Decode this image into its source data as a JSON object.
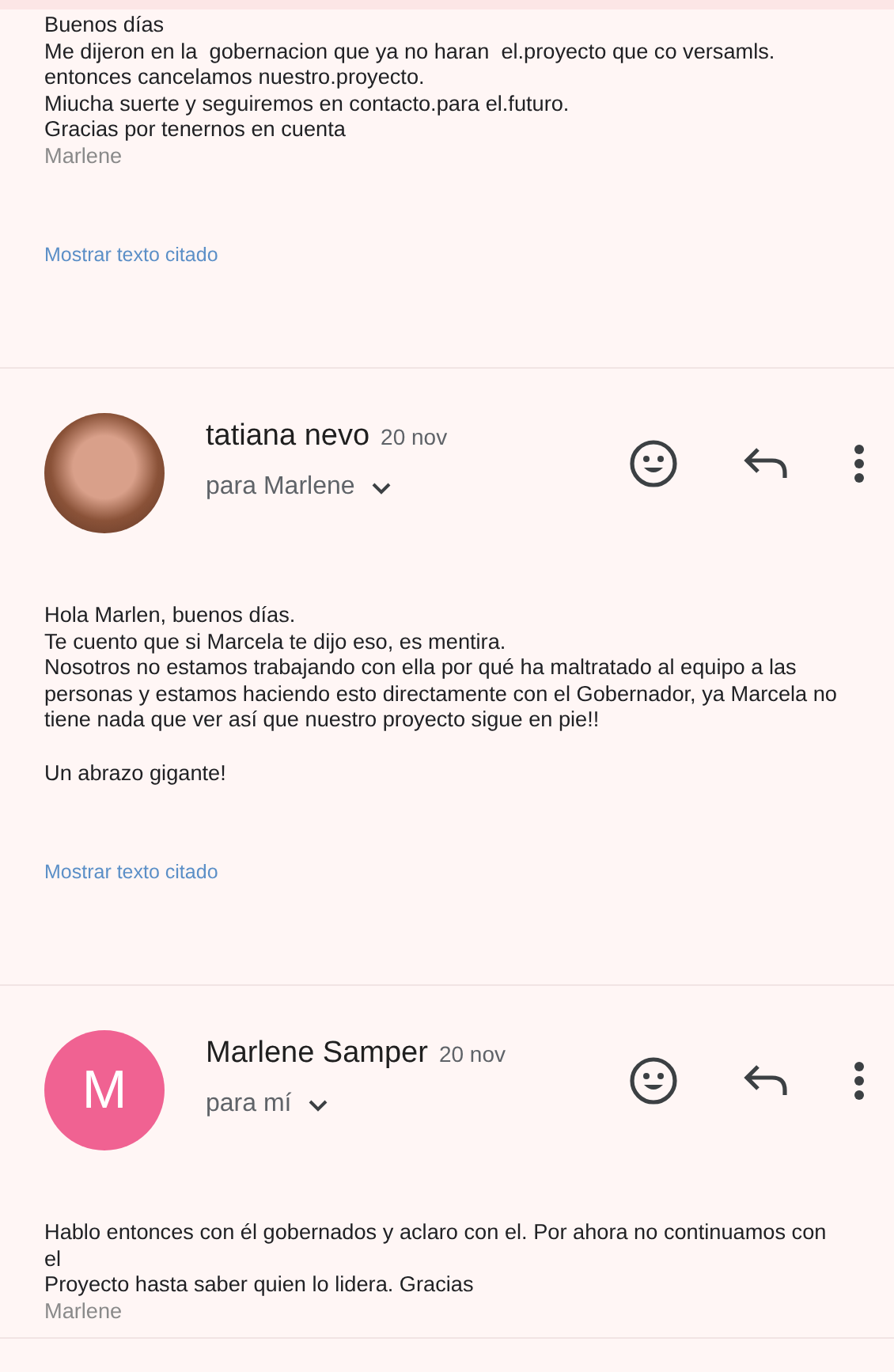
{
  "messages": [
    {
      "blocks": [
        {
          "lines": [
            "Buenos días",
            "Me dijeron en la  gobernacion que ya no haran  el.proyecto que co versamls.",
            "entonces cancelamos nuestro.proyecto.",
            "Miucha suerte y seguiremos en contacto.para el.futuro.",
            "Gracias por tenernos en cuenta"
          ]
        }
      ],
      "signature": "Marlene",
      "quoted_link": "Mostrar texto citado"
    },
    {
      "header": {
        "sender": "tatiana nevo",
        "date": "20 nov",
        "recipient": "para Marlene",
        "avatar": {
          "kind": "photo"
        }
      },
      "blocks": [
        {
          "lines": [
            "Hola Marlen, buenos días.",
            "Te cuento que si Marcela te dijo eso, es mentira.",
            "Nosotros no estamos trabajando con ella por qué ha maltratado al equipo a las personas y estamos haciendo esto directamente con el Gobernador, ya Marcela no tiene nada que ver así que nuestro proyecto sigue en pie!!"
          ]
        },
        {
          "lines": [
            "Un abrazo gigante!"
          ]
        }
      ],
      "quoted_link": "Mostrar texto citado"
    },
    {
      "header": {
        "sender": "Marlene Samper",
        "date": "20 nov",
        "recipient": "para mí",
        "avatar": {
          "kind": "letter",
          "letter": "M"
        }
      },
      "blocks": [
        {
          "lines": [
            "Hablo entonces con él gobernados y aclaro con el. Por ahora no continuamos con",
            "el",
            "Proyecto hasta saber quien lo lidera. Gracias"
          ]
        }
      ],
      "signature": "Marlene"
    }
  ]
}
